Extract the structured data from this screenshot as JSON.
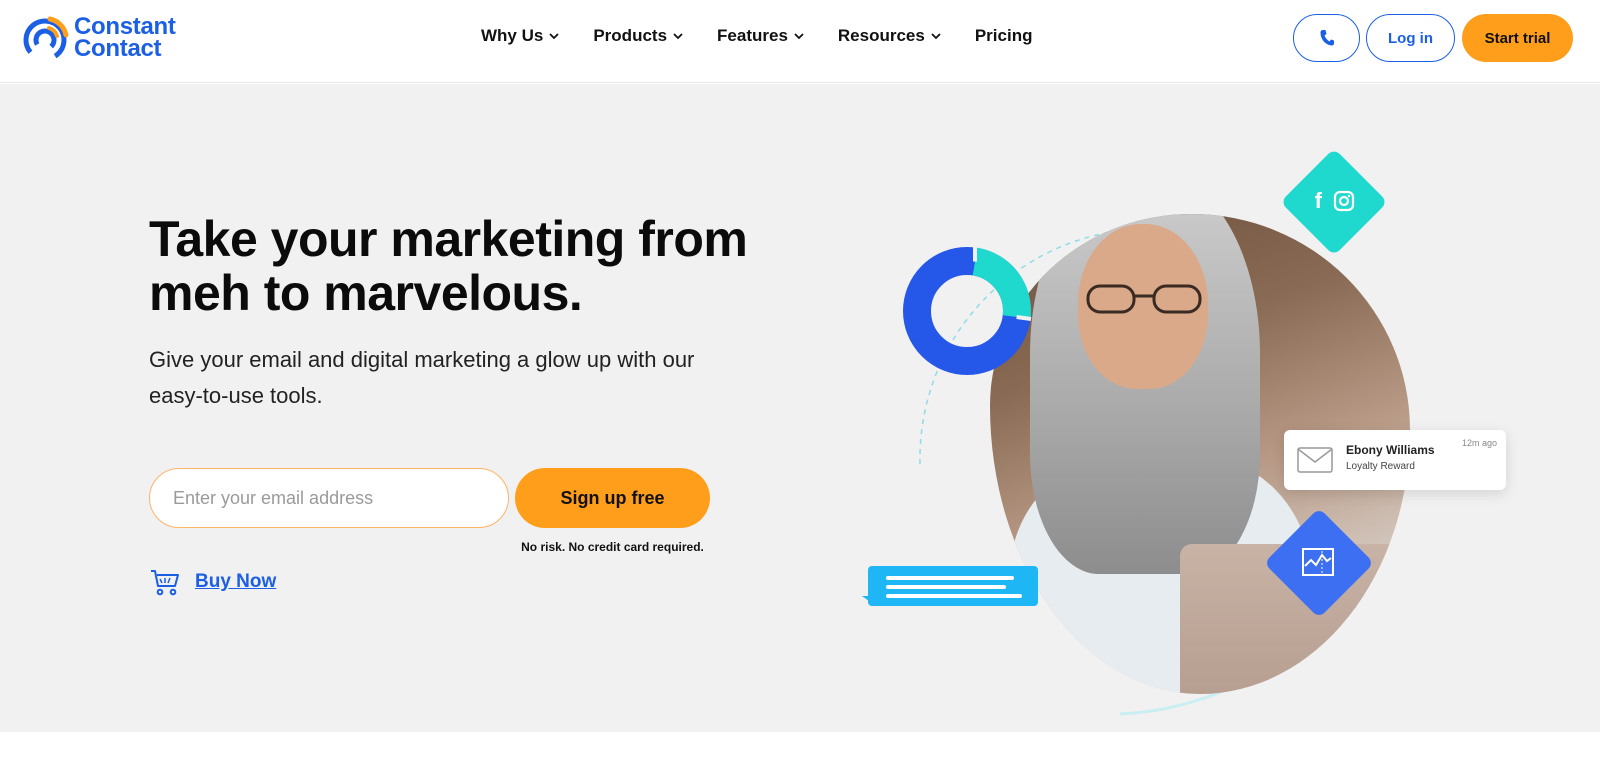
{
  "header": {
    "logo_line1": "Constant",
    "logo_line2": "Contact",
    "nav": [
      {
        "label": "Why Us",
        "has_dropdown": true
      },
      {
        "label": "Products",
        "has_dropdown": true
      },
      {
        "label": "Features",
        "has_dropdown": true
      },
      {
        "label": "Resources",
        "has_dropdown": true
      },
      {
        "label": "Pricing",
        "has_dropdown": false
      }
    ],
    "phone_icon": "phone-icon",
    "login_label": "Log in",
    "trial_label": "Start trial"
  },
  "hero": {
    "headline": "Take your marketing from meh to marvelous.",
    "subhead": "Give your email and digital marketing a glow up with our easy-to-use tools.",
    "email_placeholder": "Enter your email address",
    "email_value": "",
    "signup_label": "Sign up free",
    "no_risk_text": "No risk. No credit card required.",
    "buy_now_label": "Buy Now",
    "cart_icon": "cart-icon"
  },
  "illustration": {
    "notification": {
      "name": "Ebony Williams",
      "subtitle": "Loyalty Reward",
      "time": "12m ago"
    },
    "social_icons": [
      "facebook-icon",
      "instagram-icon"
    ],
    "chart_icon": "line-chart-icon"
  },
  "colors": {
    "brand_blue": "#1b5fe5",
    "accent_orange": "#ff9e1b",
    "teal": "#1fd9cf",
    "hero_bg": "#f1f1f1",
    "donut_blue": "#2557e8"
  }
}
